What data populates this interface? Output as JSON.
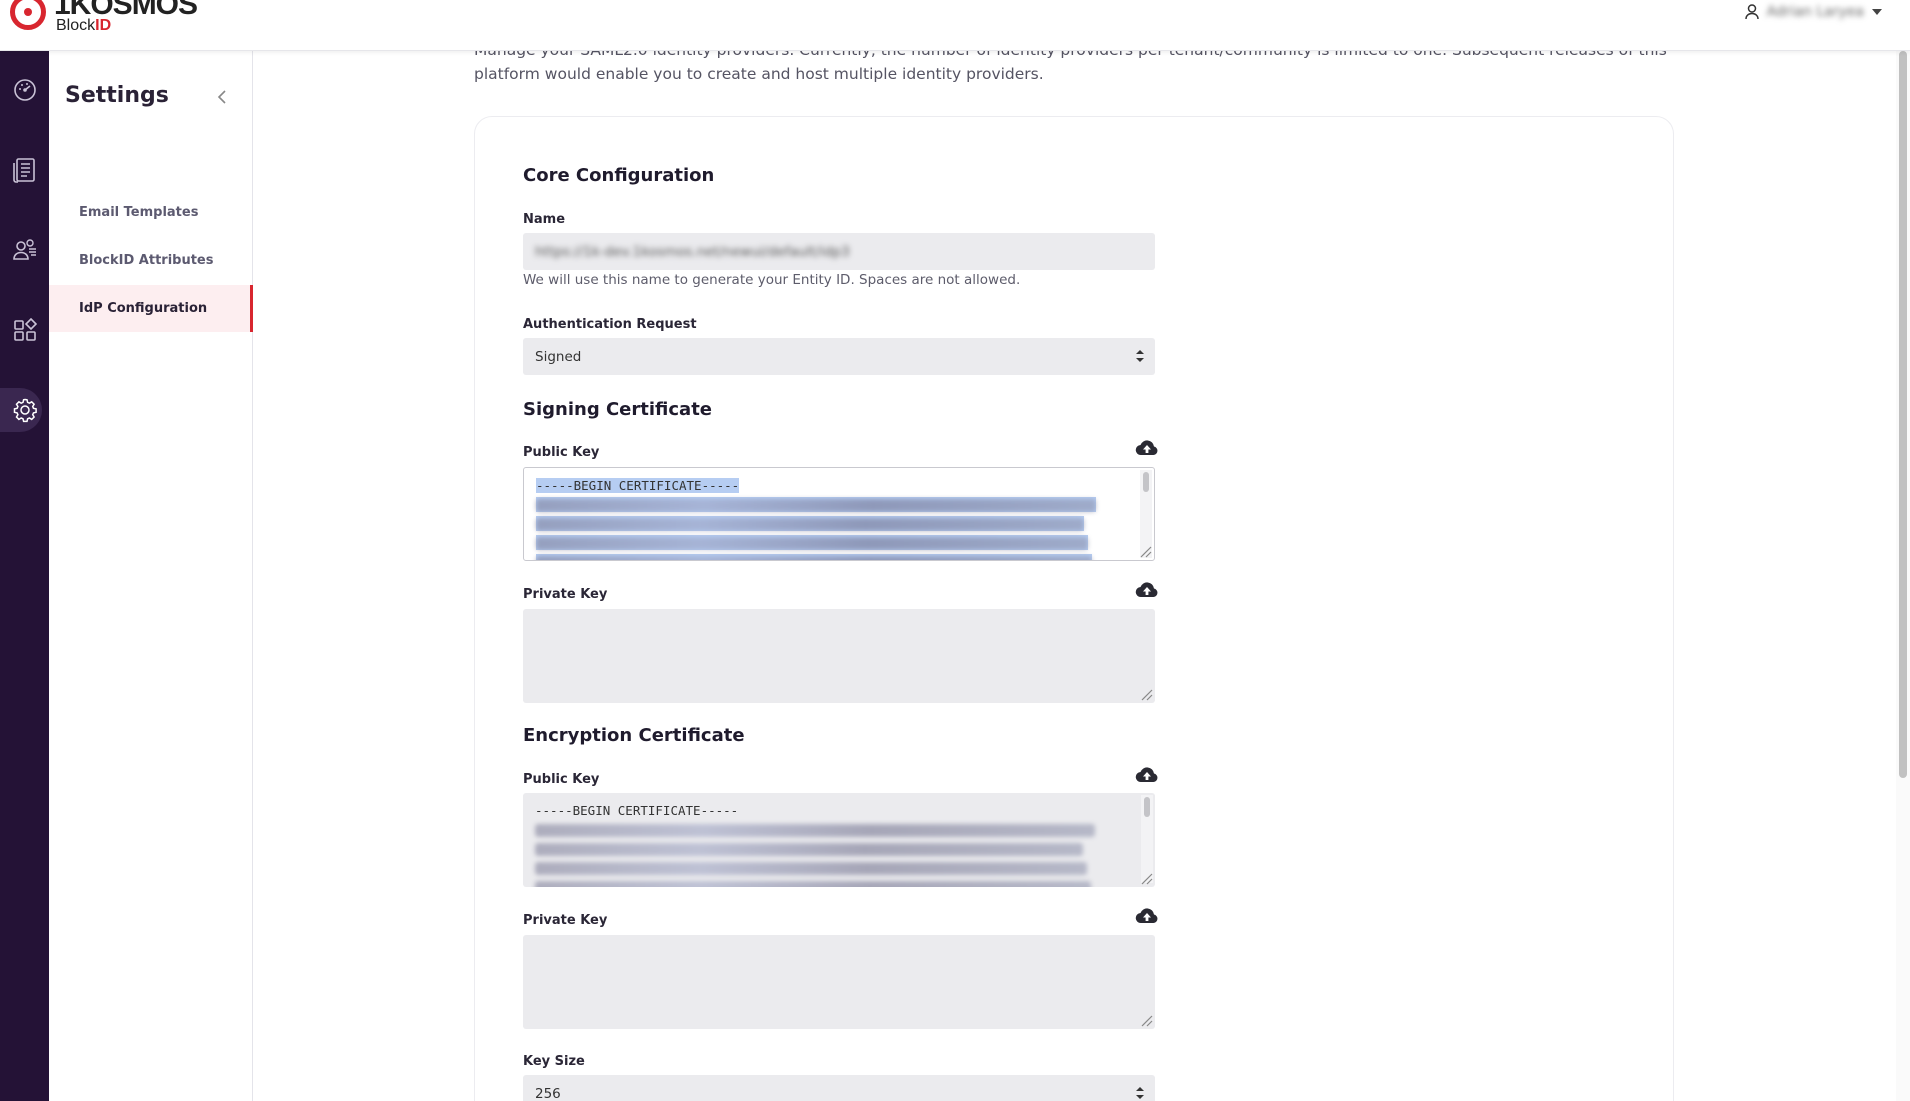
{
  "header": {
    "brand": "1KOSMOS",
    "product_prefix": "Block",
    "product_suffix": "ID",
    "user_name": "Adrian Laryea"
  },
  "rail": {
    "icons": [
      "dashboard-icon",
      "logs-icon",
      "users-icon",
      "apps-icon",
      "settings-icon"
    ],
    "active": "settings-icon"
  },
  "sidebar": {
    "title": "Settings",
    "items": [
      {
        "label": "Email Templates"
      },
      {
        "label": "BlockID Attributes"
      },
      {
        "label": "IdP Configuration"
      }
    ],
    "active_index": 2
  },
  "intro": {
    "text": "Manage your SAML2.0 identity providers. Currently, the number of identity providers per tenant/community is limited to one. Subsequent releases of this platform would enable you to create and host multiple identity providers."
  },
  "core": {
    "title": "Core Configuration",
    "name_label": "Name",
    "name_value": "https://1k-dev.1kosmos.net/newui/default/idp3",
    "name_hint": "We will use this name to generate your Entity ID. Spaces are not allowed.",
    "auth_label": "Authentication Request",
    "auth_value": "Signed"
  },
  "signing": {
    "title": "Signing Certificate",
    "public_label": "Public Key",
    "public_first_line": "-----BEGIN CERTIFICATE-----",
    "private_label": "Private Key"
  },
  "encryption": {
    "title": "Encryption Certificate",
    "public_label": "Public Key",
    "public_first_line": "-----BEGIN CERTIFICATE-----",
    "private_label": "Private Key",
    "key_size_label": "Key Size",
    "key_size_value": "256"
  },
  "colors": {
    "rail_bg": "#241236",
    "accent": "#d8262f",
    "active_item_bg": "#fdeef0",
    "input_bg": "#ebebee",
    "selection": "#b6cdf2"
  }
}
